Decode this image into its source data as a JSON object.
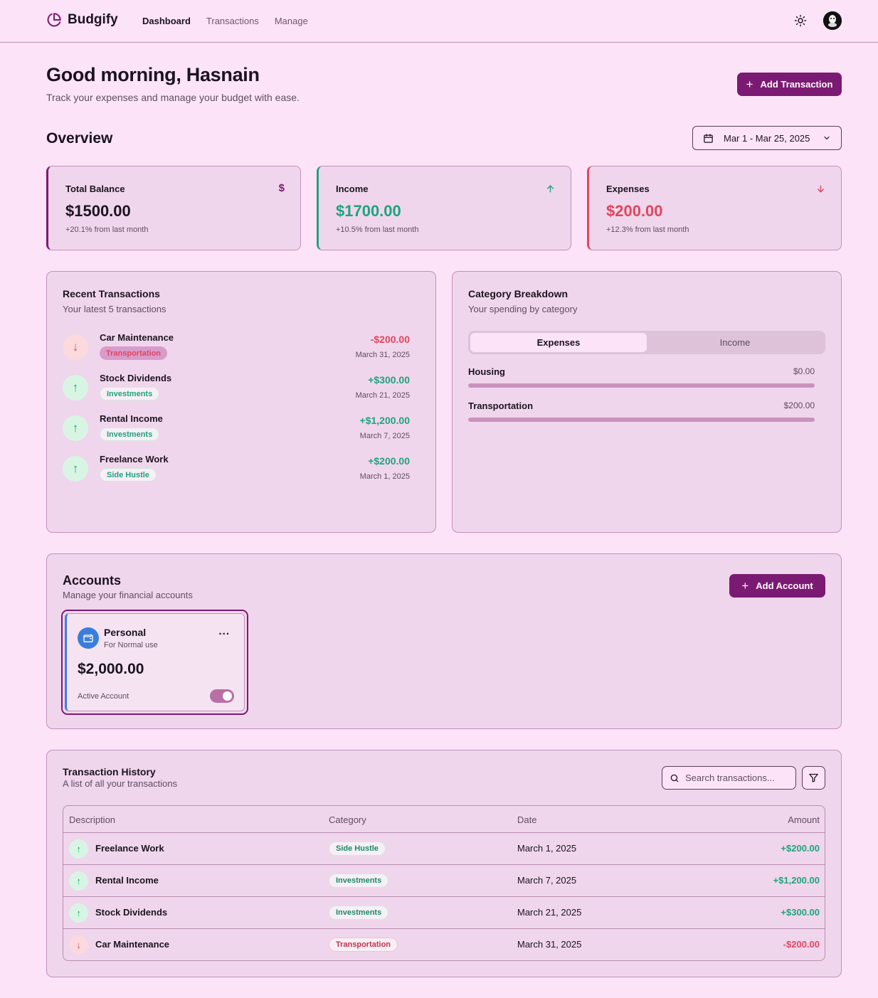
{
  "app": {
    "name": "Budgify"
  },
  "nav": {
    "links": [
      "Dashboard",
      "Transactions",
      "Manage"
    ]
  },
  "header": {
    "greeting": "Good morning, Hasnain",
    "subtitle": "Track your expenses and manage your budget with ease.",
    "add_transaction_label": "Add Transaction"
  },
  "overview": {
    "title": "Overview",
    "date_range": "Mar 1 - Mar 25, 2025",
    "cards": [
      {
        "label": "Total Balance",
        "icon": "dollar-icon",
        "value": "$1500.00",
        "note": "+20.1% from last month",
        "color": "#7b1a73"
      },
      {
        "label": "Income",
        "icon": "arrow-up-icon",
        "value": "$1700.00",
        "note": "+10.5% from last month",
        "color": "#1ea37c"
      },
      {
        "label": "Expenses",
        "icon": "arrow-down-icon",
        "value": "$200.00",
        "note": "+12.3% from last month",
        "color": "#e0465e"
      }
    ]
  },
  "recent": {
    "title": "Recent Transactions",
    "subtitle": "Your latest 5 transactions",
    "items": [
      {
        "name": "Car Maintenance",
        "category": "Transportation",
        "amount": "-$200.00",
        "date": "March 31, 2025",
        "direction": "down"
      },
      {
        "name": "Stock Dividends",
        "category": "Investments",
        "amount": "+$300.00",
        "date": "March 21, 2025",
        "direction": "up"
      },
      {
        "name": "Rental Income",
        "category": "Investments",
        "amount": "+$1,200.00",
        "date": "March 7, 2025",
        "direction": "up"
      },
      {
        "name": "Freelance Work",
        "category": "Side Hustle",
        "amount": "+$200.00",
        "date": "March 1, 2025",
        "direction": "up"
      }
    ]
  },
  "category": {
    "title": "Category Breakdown",
    "subtitle": "Your spending by category",
    "tabs": [
      "Expenses",
      "Income"
    ],
    "active_tab": "Expenses",
    "items": [
      {
        "name": "Housing",
        "amount": "$0.00",
        "fraction": 0
      },
      {
        "name": "Transportation",
        "amount": "$200.00",
        "fraction": 0
      }
    ]
  },
  "accounts": {
    "title": "Accounts",
    "subtitle": "Manage your financial accounts",
    "add_label": "Add Account",
    "items": [
      {
        "name": "Personal",
        "description": "For Normal use",
        "balance": "$2,000.00",
        "status": "Active Account",
        "active": true,
        "menu": "..."
      }
    ]
  },
  "history": {
    "title": "Transaction History",
    "subtitle": "A list of all your transactions",
    "search_placeholder": "Search transactions...",
    "columns": [
      "Description",
      "Category",
      "Date",
      "Amount"
    ],
    "rows": [
      {
        "description": "Freelance Work",
        "category": "Side Hustle",
        "date": "March 1, 2025",
        "amount": "+$200.00",
        "direction": "up"
      },
      {
        "description": "Rental Income",
        "category": "Investments",
        "date": "March 7, 2025",
        "amount": "+$1,200.00",
        "direction": "up"
      },
      {
        "description": "Stock Dividends",
        "category": "Investments",
        "date": "March 21, 2025",
        "amount": "+$300.00",
        "direction": "up"
      },
      {
        "description": "Car Maintenance",
        "category": "Transportation",
        "date": "March 31, 2025",
        "amount": "-$200.00",
        "direction": "down"
      }
    ]
  },
  "colors": {
    "brand": "#7b1a73",
    "positive": "#1ea37c",
    "negative": "#e0465e",
    "background": "#fde3f7"
  }
}
